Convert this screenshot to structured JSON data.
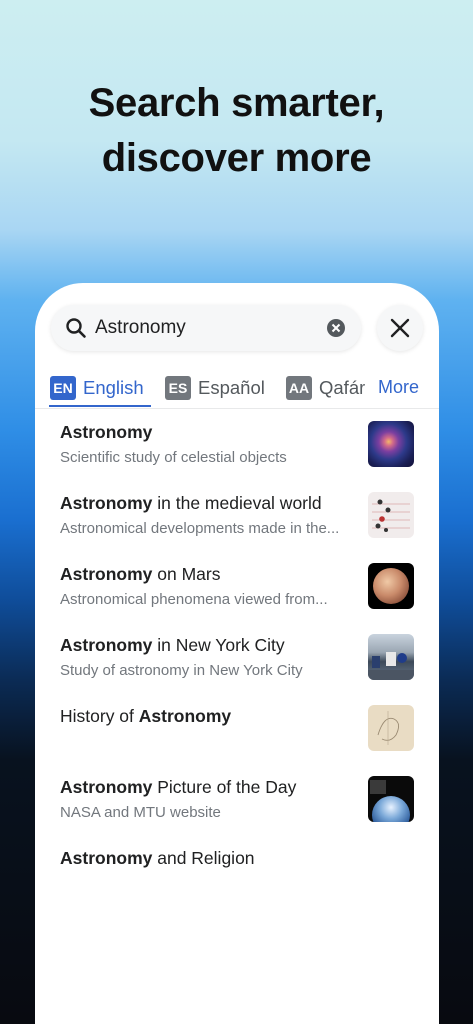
{
  "headline": {
    "line1": "Search smarter,",
    "line2": "discover more"
  },
  "search": {
    "query": "Astronomy"
  },
  "languages": {
    "items": [
      {
        "code": "EN",
        "name": "English",
        "active": true
      },
      {
        "code": "ES",
        "name": "Español",
        "active": false
      },
      {
        "code": "AA",
        "name": "Qafár",
        "active": false
      }
    ],
    "more_label": "More"
  },
  "results": [
    {
      "bold": "Astronomy",
      "rest": "",
      "pre": "",
      "description": "Scientific study of celestial objects",
      "thumb": "nebula-image"
    },
    {
      "bold": "Astronomy",
      "rest": " in the medieval world",
      "pre": "",
      "description": "Astronomical developments made in the...",
      "thumb": "manuscript-image"
    },
    {
      "bold": "Astronomy",
      "rest": " on Mars",
      "pre": "",
      "description": "Astronomical phenomena viewed from...",
      "thumb": "planet-image"
    },
    {
      "bold": "Astronomy",
      "rest": " in New York City",
      "pre": "",
      "description": "Study of astronomy in New York City",
      "thumb": "museum-image"
    },
    {
      "bold": "Astronomy",
      "rest": "",
      "pre": "History of ",
      "description": "",
      "thumb": "sketch-image"
    },
    {
      "bold": "Astronomy",
      "rest": " Picture of the Day",
      "pre": "",
      "description": "NASA and MTU website",
      "thumb": "earth-image"
    },
    {
      "bold": "Astronomy",
      "rest": " and Religion",
      "pre": "",
      "description": "",
      "thumb": ""
    }
  ]
}
